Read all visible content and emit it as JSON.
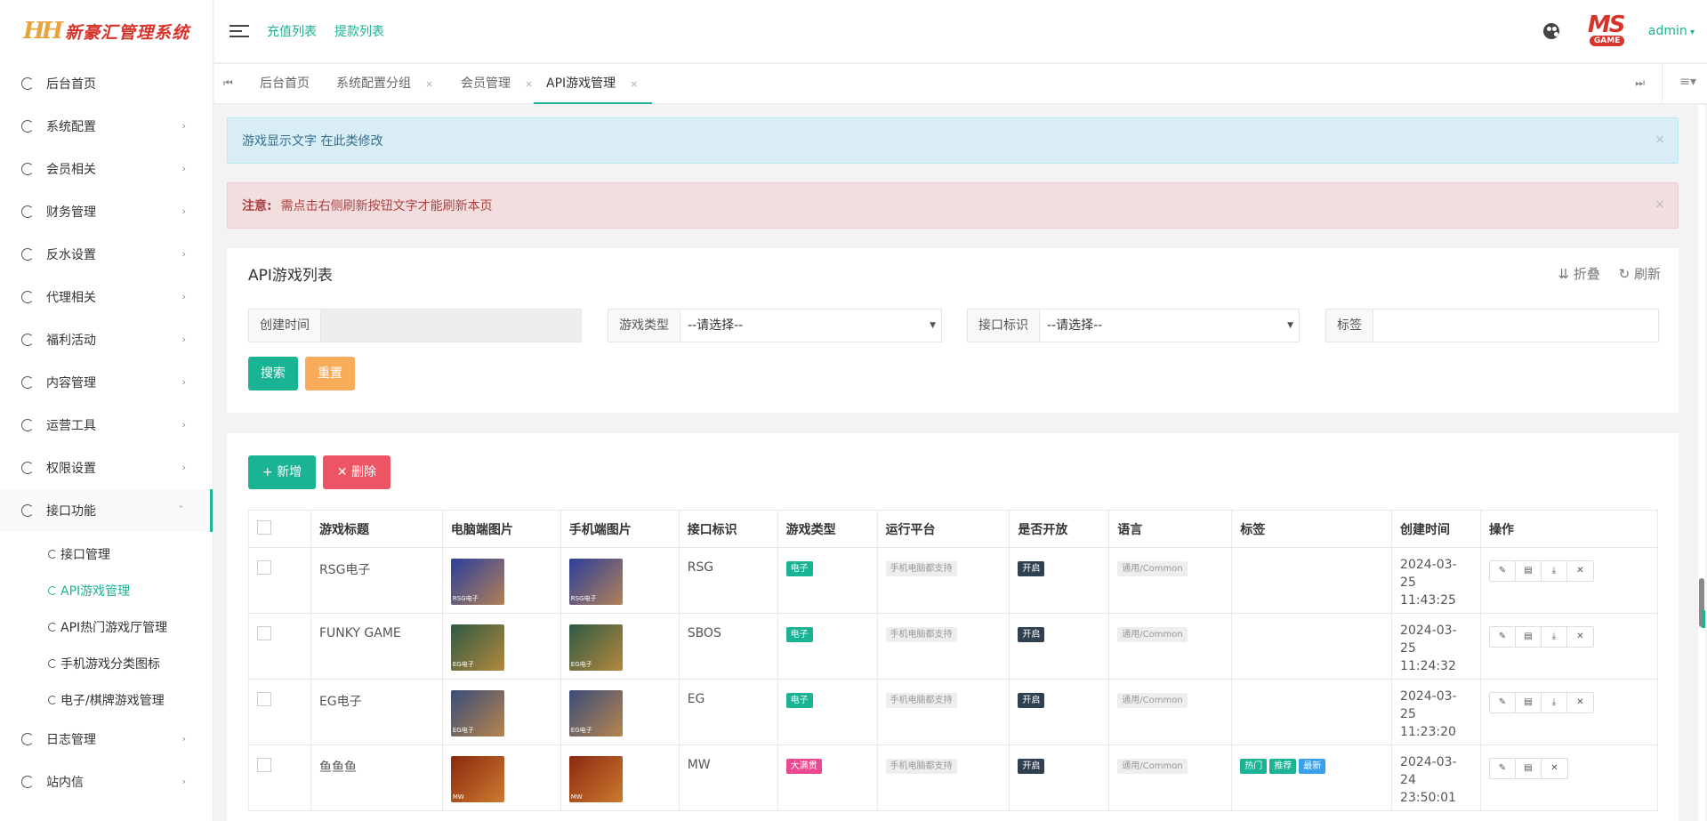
{
  "brand": {
    "mark": "HH",
    "title": "新豪汇管理系统"
  },
  "sidebar": {
    "items": [
      {
        "label": "后台首页",
        "chevron": ""
      },
      {
        "label": "系统配置",
        "chevron": "›"
      },
      {
        "label": "会员相关",
        "chevron": "›"
      },
      {
        "label": "财务管理",
        "chevron": "›"
      },
      {
        "label": "反水设置",
        "chevron": "›"
      },
      {
        "label": "代理相关",
        "chevron": "›"
      },
      {
        "label": "福利活动",
        "chevron": "›"
      },
      {
        "label": "内容管理",
        "chevron": "›"
      },
      {
        "label": "运营工具",
        "chevron": "›"
      },
      {
        "label": "权限设置",
        "chevron": "›"
      },
      {
        "label": "接口功能",
        "chevron": "ˇ"
      }
    ],
    "sub_items": [
      "接口管理",
      "API游戏管理",
      "API热门游戏厅管理",
      "手机游戏分类图标",
      "电子/棋牌游戏管理"
    ],
    "after_items": [
      {
        "label": "日志管理",
        "chevron": "›"
      },
      {
        "label": "站内信",
        "chevron": "›"
      }
    ]
  },
  "topbar": {
    "links": [
      "充值列表",
      "提款列表"
    ],
    "avatar_ms": "MS",
    "avatar_game": "GAME",
    "user": "admin"
  },
  "tabs": [
    {
      "label": "后台首页",
      "closable": false
    },
    {
      "label": "系统配置分组",
      "closable": true
    },
    {
      "label": "会员管理",
      "closable": true
    },
    {
      "label": "API游戏管理",
      "closable": true
    }
  ],
  "alerts": {
    "info": "游戏显示文字 在此类修改",
    "danger_strong": "注意:",
    "danger_text": "需点击右侧刷新按钮文字才能刷新本页",
    "close": "×"
  },
  "search": {
    "title": "API游戏列表",
    "collapse": "⇊ 折叠",
    "refresh": "↻ 刷新",
    "fields": {
      "created_label": "创建时间",
      "created_value": "",
      "game_type_label": "游戏类型",
      "game_type_value": "--请选择--",
      "api_label": "接口标识",
      "api_value": "--请选择--",
      "tag_label": "标签",
      "tag_value": ""
    },
    "search_btn": "搜索",
    "reset_btn": "重置"
  },
  "table": {
    "add_btn": "+ 新增",
    "del_btn": "✕ 删除",
    "headers": [
      "游戏标题",
      "电脑端图片",
      "手机端图片",
      "接口标识",
      "游戏类型",
      "运行平台",
      "是否开放",
      "语言",
      "标签",
      "创建时间",
      "操作"
    ],
    "rows": [
      {
        "title": "RSG电子",
        "thumb_label": "RSG电子",
        "thumb_color": "#2b3f9c",
        "api": "RSG",
        "type": "电子",
        "type_color": "green",
        "platform": "手机电脑都支持",
        "open": "开启",
        "lang": "通用/Common",
        "tags": [],
        "date": "2024-03-25",
        "time": "11:43:25",
        "ops": 4
      },
      {
        "title": "FUNKY GAME",
        "thumb_label": "EG电子",
        "thumb_color": "#2f5a44",
        "api": "SBOS",
        "type": "电子",
        "type_color": "green",
        "platform": "手机电脑都支持",
        "open": "开启",
        "lang": "通用/Common",
        "tags": [],
        "date": "2024-03-25",
        "time": "11:24:32",
        "ops": 4
      },
      {
        "title": "EG电子",
        "thumb_label": "EG电子",
        "thumb_color": "#3a4d7a",
        "api": "EG",
        "type": "电子",
        "type_color": "green",
        "platform": "手机电脑都支持",
        "open": "开启",
        "lang": "通用/Common",
        "tags": [],
        "date": "2024-03-25",
        "time": "11:23:20",
        "ops": 4
      },
      {
        "title": "鱼鱼鱼",
        "thumb_label": "MW",
        "thumb_color": "#8a2a10",
        "api": "MW",
        "type": "大满贯",
        "type_color": "pink",
        "platform": "手机电脑都支持",
        "open": "开启",
        "lang": "通用/Common",
        "tags": [
          {
            "text": "热门",
            "color": "teal"
          },
          {
            "text": "推荐",
            "color": "green"
          },
          {
            "text": "最新",
            "color": "blue"
          }
        ],
        "date": "2024-03-24",
        "time": "23:50:01",
        "ops": 3
      }
    ]
  },
  "icons": {
    "edit": "✎",
    "detail": "▤",
    "download": "⤓",
    "delete": "✕"
  },
  "colors": {
    "accent": "#1ab394",
    "danger": "#ed5565",
    "warning": "#f8ac59",
    "brand_red": "#d8332a"
  }
}
